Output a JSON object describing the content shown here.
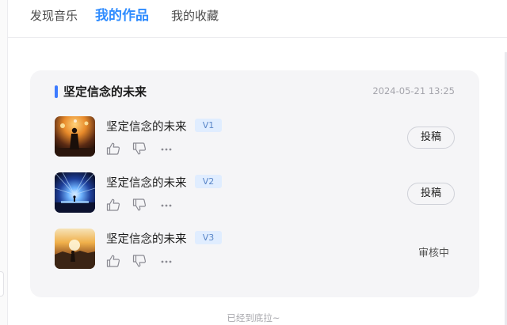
{
  "tabs": [
    {
      "label": "发现音乐",
      "active": false
    },
    {
      "label": "我的作品",
      "active": true
    },
    {
      "label": "我的收藏",
      "active": false
    }
  ],
  "colors": {
    "accent": "#2f8cff",
    "title_bar": "#3d7bff",
    "version_bg": "#e0edff"
  },
  "card": {
    "title": "坚定信念的未来",
    "timestamp": "2024-05-21 13:25",
    "items": [
      {
        "title": "坚定信念的未来",
        "version": "V1",
        "action_label": "投稿",
        "status": ""
      },
      {
        "title": "坚定信念的未来",
        "version": "V2",
        "action_label": "投稿",
        "status": ""
      },
      {
        "title": "坚定信念的未来",
        "version": "V3",
        "action_label": "",
        "status": "审核中"
      }
    ]
  },
  "icons": {
    "like": "thumbs-up-icon",
    "dislike": "thumbs-down-icon",
    "more": "more-icon"
  },
  "footer": {
    "text": "已经到底拉~"
  }
}
